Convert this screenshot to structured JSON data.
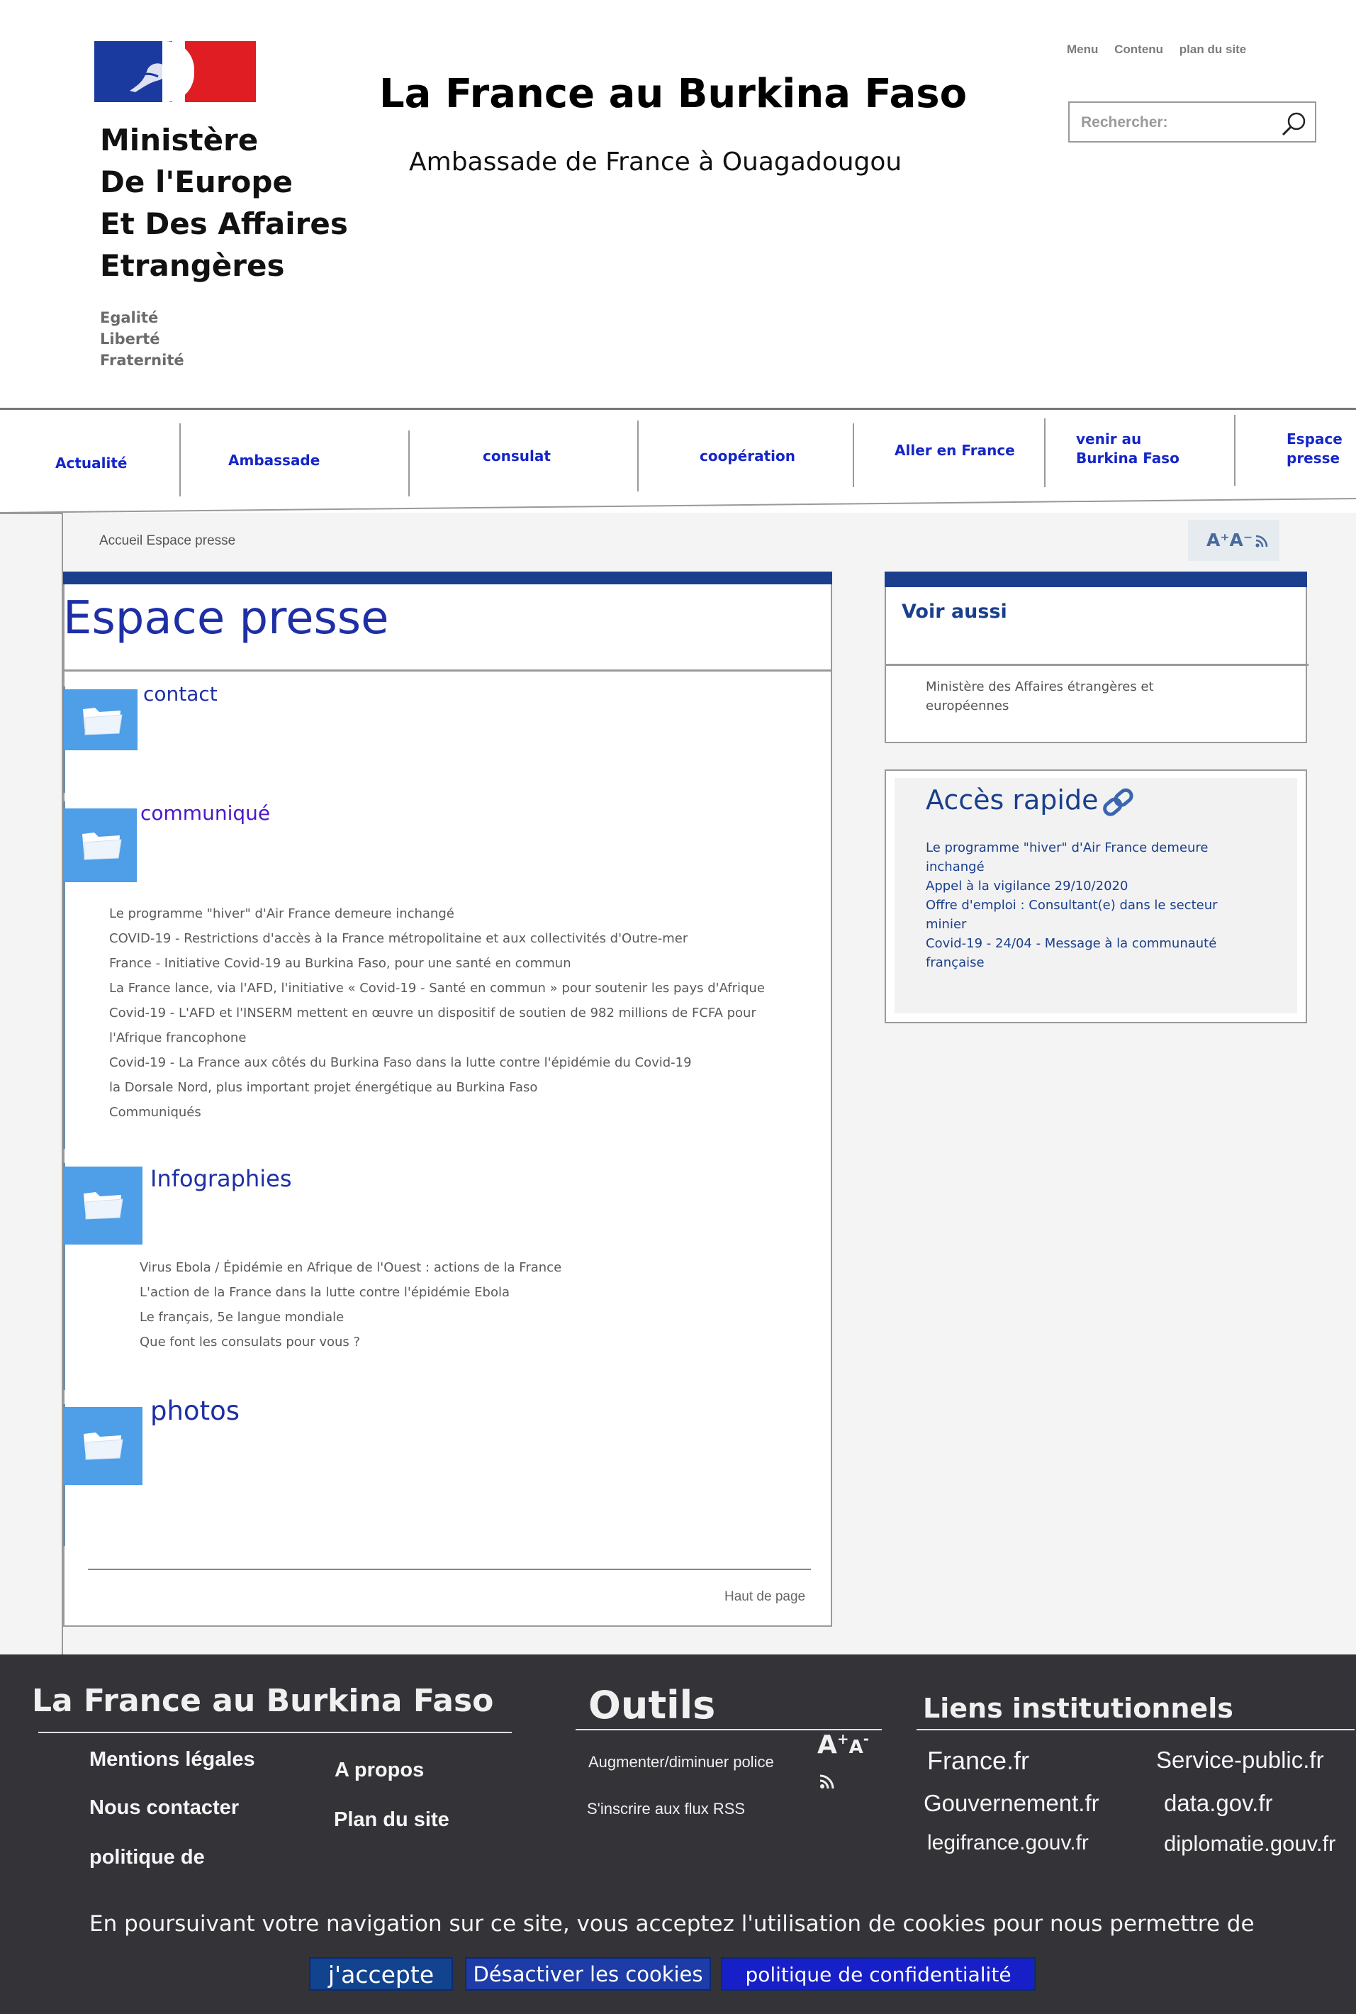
{
  "header": {
    "ministry_lines": [
      "Ministère",
      "De l'Europe",
      "Et Des Affaires",
      "Etrangères"
    ],
    "motto": [
      "Egalité",
      "Liberté",
      "Fraternité"
    ],
    "site_title": "La France au Burkina Faso",
    "site_subtitle": "Ambassade de France à Ouagadougou",
    "top_links": [
      "Menu",
      "Contenu",
      "plan du site"
    ],
    "search_placeholder": "Rechercher:"
  },
  "nav": {
    "items": [
      {
        "label": "Actualité"
      },
      {
        "label": "Ambassade"
      },
      {
        "label": "consulat"
      },
      {
        "label": "coopération"
      },
      {
        "label": "Aller en France"
      },
      {
        "label": "venir au Burkina Faso"
      },
      {
        "label": "Espace presse"
      }
    ]
  },
  "breadcrumb": "Accueil Espace presse",
  "tools": {
    "font_size": "A⁺A⁻",
    "rss_icon": "rss-icon"
  },
  "main": {
    "title": "Espace presse",
    "sections": [
      {
        "title": "contact",
        "links": []
      },
      {
        "title": "communiqué",
        "links": [
          "Le programme \"hiver\" d'Air France demeure inchangé",
          "COVID-19 - Restrictions d'accès à la France métropolitaine et aux collectivités d'Outre-mer",
          "France - Initiative Covid-19 au Burkina Faso, pour une santé en commun",
          "La France lance, via l'AFD, l'initiative « Covid-19 - Santé en commun » pour soutenir les pays d'Afrique",
          "Covid-19 - L'AFD et l'INSERM mettent en œuvre un dispositif de soutien de 982 millions de FCFA pour",
          "l'Afrique francophone",
          "Covid-19 - La France aux côtés du Burkina Faso dans la lutte contre l'épidémie du Covid-19",
          "la Dorsale Nord, plus important projet énergétique au Burkina Faso",
          "Communiqués"
        ]
      },
      {
        "title": "Infographies",
        "links": [
          "Virus Ebola / Épidémie en Afrique de l'Ouest : actions de la France",
          "L'action de la France dans la lutte contre l'épidémie Ebola",
          "Le français, 5e langue mondiale",
          "Que font les consulats pour vous ?"
        ]
      },
      {
        "title": "photos",
        "links": []
      }
    ],
    "back_to_top": "Haut de page"
  },
  "sidebar": {
    "voir_aussi": {
      "title": "Voir aussi",
      "link": "Ministère des Affaires étrangères et européennes"
    },
    "acces_rapide": {
      "title": "Accès rapide",
      "links": [
        "Le programme \"hiver\" d'Air France demeure inchangé",
        "Appel à la vigilance 29/10/2020",
        "Offre d'emploi : Consultant(e) dans le secteur minier",
        "Covid-19 - 24/04 - Message à la communauté française"
      ]
    }
  },
  "footer": {
    "col1_title": "La France au Burkina Faso",
    "col1_links": [
      "Mentions légales",
      "Nous contacter",
      "politique de",
      "A propos",
      "Plan du site"
    ],
    "col2_title": "Outils",
    "col2_tools": [
      "Augmenter/diminuer police",
      "S'inscrire aux flux RSS"
    ],
    "col3_title": "Liens institutionnels",
    "col3_links": [
      "France.fr",
      "Service-public.fr",
      "Gouvernement.fr",
      "data.gov.fr",
      "legifrance.gouv.fr",
      "diplomatie.gouv.fr"
    ]
  },
  "cookie": {
    "text": "En poursuivant votre navigation sur ce site, vous acceptez l'utilisation de cookies pour nous permettre de",
    "accept": "j'accepte",
    "disable": "Désactiver les cookies",
    "policy": "politique de confidentialité"
  },
  "colors": {
    "brand_blue": "#1a3f8c",
    "link_blue": "#1526c8",
    "folder_blue": "#4e9ee8",
    "footer_bg": "#333338"
  }
}
